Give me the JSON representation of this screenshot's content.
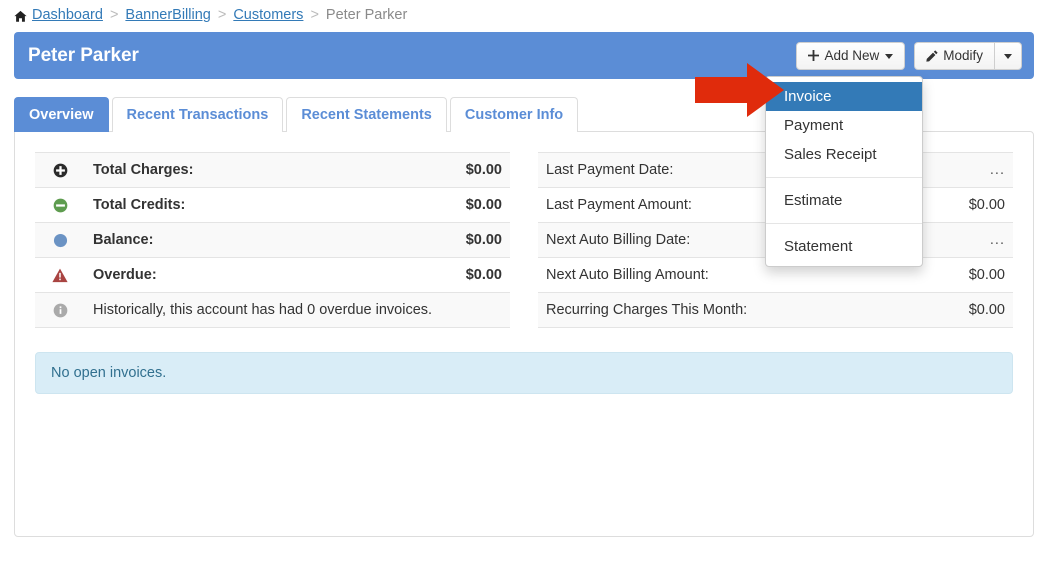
{
  "breadcrumb": {
    "home_icon": "home-icon",
    "separator": ">",
    "items": [
      {
        "label": "Dashboard",
        "link": true
      },
      {
        "label": "BannerBilling",
        "link": true
      },
      {
        "label": "Customers",
        "link": true
      },
      {
        "label": "Peter Parker",
        "link": false
      }
    ]
  },
  "header": {
    "title": "Peter Parker",
    "background_color": "#5b8dd6",
    "add_new_button": {
      "label": "Add New",
      "icon": "plus-icon",
      "caret": true
    },
    "modify_button": {
      "label": "Modify",
      "icon": "pencil-icon"
    },
    "modify_caret_button": {
      "label": "",
      "icon": "caret-down-icon"
    }
  },
  "tabs": [
    {
      "label": "Overview",
      "active": true
    },
    {
      "label": "Recent Transactions",
      "active": false
    },
    {
      "label": "Recent Statements",
      "active": false
    },
    {
      "label": "Customer Info",
      "active": false
    }
  ],
  "dropdown": {
    "open": true,
    "highlight_color": "#337ab7",
    "items": [
      {
        "label": "Invoice",
        "active": true,
        "divider_after": false
      },
      {
        "label": "Payment",
        "active": false,
        "divider_after": false
      },
      {
        "label": "Sales Receipt",
        "active": false,
        "divider_after": true
      },
      {
        "label": "Estimate",
        "active": false,
        "divider_after": true
      },
      {
        "label": "Statement",
        "active": false,
        "divider_after": false
      }
    ]
  },
  "annotation": {
    "arrow": {
      "color": "#e02b0c",
      "direction": "right",
      "points_to": "Invoice"
    }
  },
  "left_table": {
    "rows": [
      {
        "icon": "plus-circle-icon",
        "icon_color": "#2b2b2b",
        "label": "Total Charges:",
        "value": "$0.00",
        "bold": true
      },
      {
        "icon": "minus-circle-icon",
        "icon_color": "#5e9c4f",
        "label": "Total Credits:",
        "value": "$0.00",
        "bold": true
      },
      {
        "icon": "circle-icon",
        "icon_color": "#6b93c4",
        "label": "Balance:",
        "value": "$0.00",
        "bold": true
      },
      {
        "icon": "warning-triangle-icon",
        "icon_color": "#a94442",
        "label": "Overdue:",
        "value": "$0.00",
        "bold": true
      }
    ],
    "note": {
      "icon": "info-circle-icon",
      "icon_color": "#aaaaaa",
      "text": "Historically, this account has had 0 overdue invoices."
    }
  },
  "right_table": {
    "rows": [
      {
        "label": "Last Payment Date:",
        "value": "..."
      },
      {
        "label": "Last Payment Amount:",
        "value": "$0.00"
      },
      {
        "label": "Next Auto Billing Date:",
        "value": "..."
      },
      {
        "label": "Next Auto Billing Amount:",
        "value": "$0.00"
      },
      {
        "label": "Recurring Charges This Month:",
        "value": "$0.00"
      }
    ]
  },
  "alert": {
    "text": "No open invoices.",
    "background_color": "#d9edf7",
    "text_color": "#31708f"
  }
}
